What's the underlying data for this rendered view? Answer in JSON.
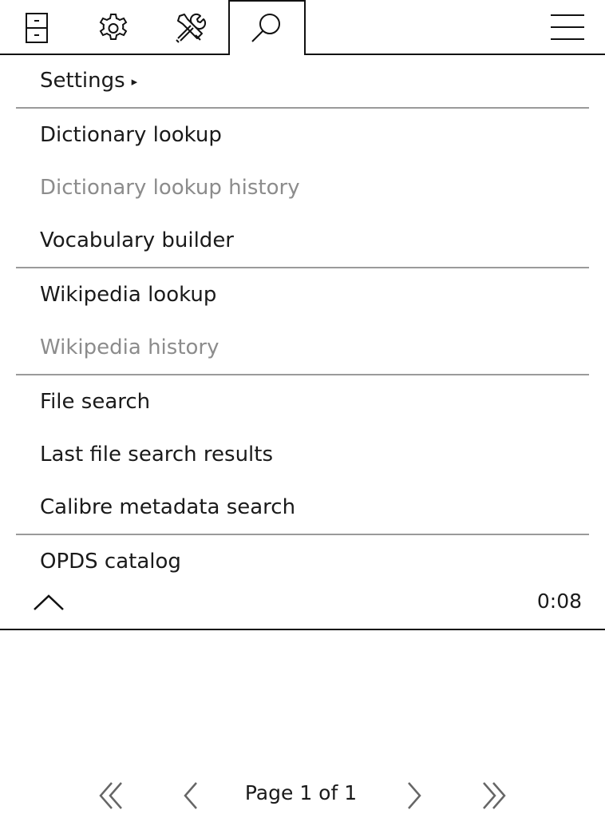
{
  "tabs": [
    {
      "name": "filing-cabinet-icon"
    },
    {
      "name": "gear-icon"
    },
    {
      "name": "tools-icon"
    },
    {
      "name": "search-icon",
      "active": true
    }
  ],
  "menu": {
    "settings_label": "Settings",
    "settings_arrow": "▸",
    "items": [
      {
        "label": "Dictionary lookup",
        "enabled": true
      },
      {
        "label": "Dictionary lookup history",
        "enabled": false
      },
      {
        "label": "Vocabulary builder",
        "enabled": true
      },
      {
        "label": "Wikipedia lookup",
        "enabled": true
      },
      {
        "label": "Wikipedia history",
        "enabled": false
      },
      {
        "label": "File search",
        "enabled": true
      },
      {
        "label": "Last file search results",
        "enabled": true
      },
      {
        "label": "Calibre metadata search",
        "enabled": true
      },
      {
        "label": "OPDS catalog",
        "enabled": true
      }
    ]
  },
  "footer": {
    "time": "0:08"
  },
  "pager": {
    "label": "Page 1 of 1"
  },
  "colors": {
    "text": "#1a1a1a",
    "disabled": "#8c8c8c",
    "separator": "#9a9a9a"
  }
}
